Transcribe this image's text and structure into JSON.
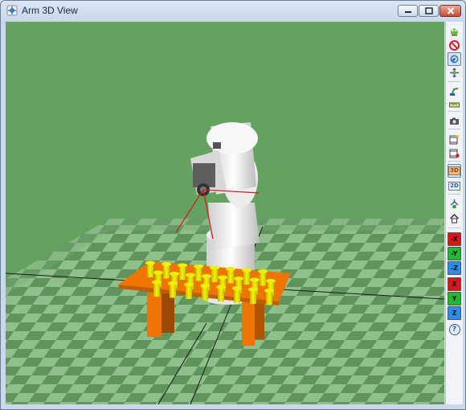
{
  "window": {
    "title": "Arm 3D View",
    "minimize_glyph": "‒",
    "maximize_glyph": "▢",
    "close_glyph": "✕"
  },
  "colors": {
    "background_green": "#63a35f",
    "floor_light": "#8fbf8b",
    "floor_dark": "#5f955c",
    "table_orange": "#f07400",
    "peg_yellow": "#e8e800",
    "robot_white": "#f2f2f2"
  },
  "toolbar": {
    "buttons": [
      {
        "icon": "frog-fit-icon"
      },
      {
        "icon": "no-entry-icon"
      },
      {
        "icon": "rotate-view-icon",
        "active": true
      },
      {
        "icon": "move-view-icon"
      },
      {
        "icon": "robot-pose-icon"
      },
      {
        "icon": "ruler-icon"
      },
      {
        "icon": "camera-icon"
      },
      {
        "icon": "film-edit-icon"
      },
      {
        "icon": "film-record-icon"
      },
      {
        "icon": "3d-view-icon",
        "label": "3D",
        "active": true
      },
      {
        "icon": "2d-view-icon",
        "label": "2D"
      },
      {
        "icon": "tree-home-icon"
      },
      {
        "icon": "home-icon"
      }
    ],
    "axes_minus": [
      "-X",
      "-Y",
      "-Z"
    ],
    "axes_plus": [
      "X",
      "Y",
      "Z"
    ],
    "help_label": "?"
  }
}
